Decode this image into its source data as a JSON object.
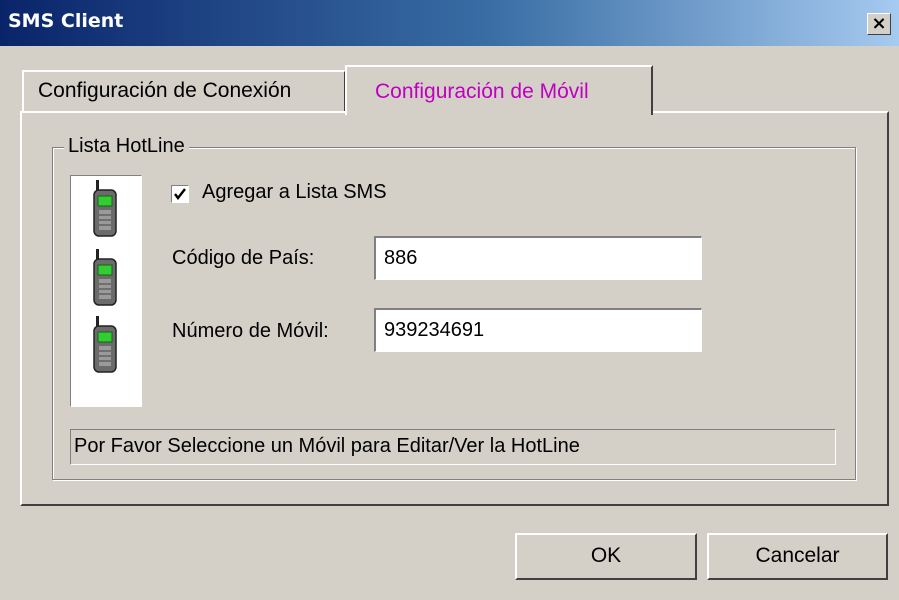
{
  "window": {
    "title": "SMS Client",
    "close_label": "×"
  },
  "tabs": [
    {
      "label": "Configuración de Conexión",
      "active": false
    },
    {
      "label": "Configuración de Móvil",
      "active": true,
      "color": "#c000c0"
    }
  ],
  "group": {
    "legend": "Lista HotLine",
    "phones": [
      {
        "icon": "mobile-phone-icon"
      },
      {
        "icon": "mobile-phone-icon"
      },
      {
        "icon": "mobile-phone-icon"
      }
    ],
    "checkbox": {
      "label": "Agregar a Lista SMS",
      "checked": true
    },
    "fields": [
      {
        "label": "Código de País:",
        "value": "886"
      },
      {
        "label": "Número de Móvil:",
        "value": "939234691"
      }
    ],
    "status": "Por Favor Seleccione un Móvil para Editar/Ver la HotLine"
  },
  "buttons": {
    "ok": "OK",
    "cancel": "Cancelar"
  }
}
